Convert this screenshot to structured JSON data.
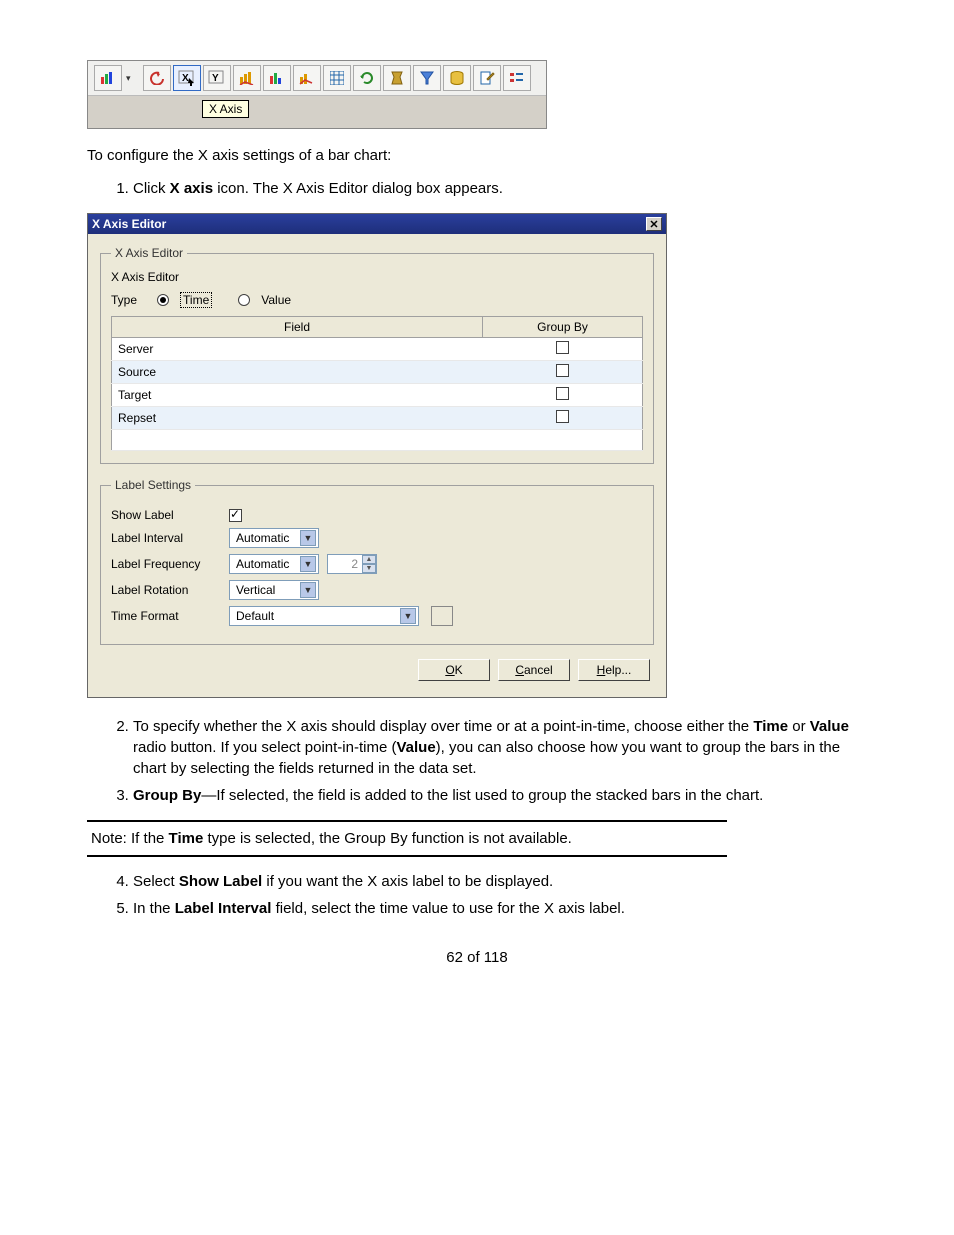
{
  "toolbar": {
    "tooltip": "X Axis"
  },
  "intro": "To configure the X axis settings of a bar chart:",
  "step1_prefix": "Click ",
  "step1_bold": "X axis",
  "step1_suffix": " icon. The X Axis Editor dialog box appears.",
  "dialog": {
    "title": "X Axis Editor",
    "group1_legend": "X Axis Editor",
    "sub_label": "X Axis Editor",
    "type_label": "Type",
    "radio_time": "Time",
    "radio_value": "Value",
    "table": {
      "col_field": "Field",
      "col_groupby": "Group By",
      "rows": [
        "Server",
        "Source",
        "Target",
        "Repset"
      ]
    },
    "group2_legend": "Label Settings",
    "show_label": "Show Label",
    "label_interval": "Label Interval",
    "label_interval_value": "Automatic",
    "label_frequency": "Label Frequency",
    "label_frequency_value": "Automatic",
    "label_frequency_spin": "2",
    "label_rotation": "Label Rotation",
    "label_rotation_value": "Vertical",
    "time_format": "Time Format",
    "time_format_value": "Default",
    "btn_ok": "OK",
    "btn_ok_m": "O",
    "btn_ok_rest": "K",
    "btn_cancel_m": "C",
    "btn_cancel_rest": "ancel",
    "btn_help_m": "H",
    "btn_help_rest": "elp..."
  },
  "step2_a": "To specify whether the X axis should display over time or at a point-in-time, choose either the ",
  "step2_b1": "Time",
  "step2_c": " or ",
  "step2_b2": "Value",
  "step2_d": " radio button. If you select point-in-time (",
  "step2_b3": "Value",
  "step2_e": "), you can also choose how you want to group the bars in the chart by selecting the fields returned in the data set.",
  "step3_b": "Group By",
  "step3_rest": "—If selected, the field is added to the list used to group the stacked bars in the chart.",
  "note_prefix": "Note:   If the ",
  "note_bold": "Time",
  "note_suffix": " type is selected, the Group By function is not available.",
  "step4_a": "Select ",
  "step4_b": "Show Label",
  "step4_c": " if you want the X axis label to be displayed.",
  "step5_a": "In the ",
  "step5_b": "Label Interval",
  "step5_c": " field, select the time value to use for the X axis label.",
  "footer": "62 of 118"
}
